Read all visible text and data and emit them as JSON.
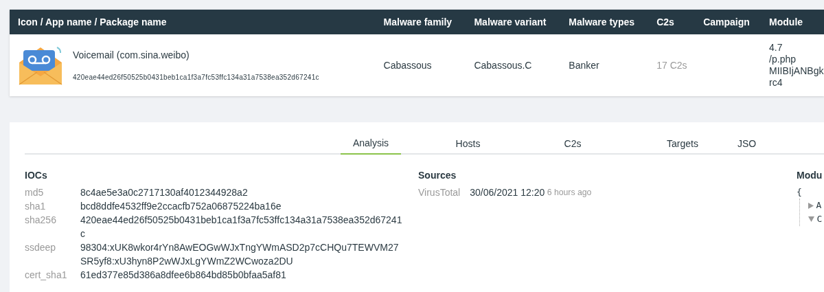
{
  "table": {
    "columns": [
      "Icon / App name / Package name",
      "Malware family",
      "Malware variant",
      "Malware types",
      "C2s",
      "Campaign",
      "Module"
    ],
    "rows": [
      {
        "app_name": "Voicemail (com.sina.weibo)",
        "hash": "420eae44ed26f50525b0431beb1ca1f3a7fc53ffc134a31a7538ea352d67241c",
        "family": "Cabassous",
        "variant": "Cabassous.C",
        "types": "Banker",
        "c2s": "17 C2s",
        "module": [
          "4.7",
          "/p.php",
          "MIIBIjANBgk",
          "rc4"
        ]
      }
    ]
  },
  "tabs": [
    {
      "label": "Analysis",
      "selected": true
    },
    {
      "label": "Hosts",
      "selected": false
    },
    {
      "label": "C2s",
      "selected": false
    },
    {
      "label": "Targets",
      "selected": false
    },
    {
      "label": "JSO",
      "selected": false
    }
  ],
  "iocs": {
    "title": "IOCs",
    "items": [
      {
        "key": "md5",
        "value": "8c4ae5e3a0c2717130af4012344928a2"
      },
      {
        "key": "sha1",
        "value": "bcd8ddfe4532ff9e2ccacfb752a06875224ba16e"
      },
      {
        "key": "sha256",
        "value": "420eae44ed26f50525b0431beb1ca1f3a7fc53ffc134a31a7538ea352d67241c"
      },
      {
        "key": "ssdeep",
        "value": "98304:xUK8wkor4rYn8AwEOGwWJxTngYWmASD2p7cCHQu7TEWVM27SR5yf8:xU3hyn8P2wWJxLgYWmZ2WCwoza2DU"
      },
      {
        "key": "cert_sha1",
        "value": "61ed377e85d386a8dfee6b864bd85b0bfaa5af81"
      }
    ]
  },
  "sources": {
    "title": "Sources",
    "items": [
      {
        "name": "VirusTotal",
        "date": "30/06/2021 12:20",
        "ago": "6 hours ago"
      }
    ]
  },
  "module": {
    "title": "Modu",
    "brace": "{",
    "nodes": [
      {
        "label": "A",
        "expanded": false
      },
      {
        "label": "C",
        "expanded": true
      }
    ]
  }
}
